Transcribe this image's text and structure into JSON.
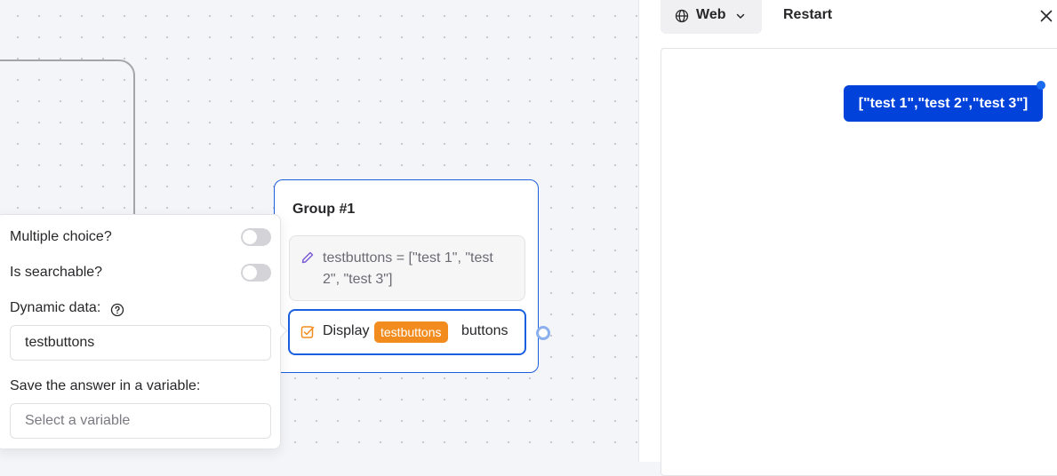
{
  "canvas": {
    "group": {
      "title": "Group #1",
      "set_variable_text": "testbuttons = [\"test 1\", \"test 2\", \"test 3\"]",
      "buttons_block": {
        "prefix": "Display",
        "variable_tag": "testbuttons",
        "suffix": "buttons"
      }
    }
  },
  "settings_popover": {
    "multiple_choice_label": "Multiple choice?",
    "multiple_choice_enabled": false,
    "searchable_label": "Is searchable?",
    "searchable_enabled": false,
    "dynamic_data_label": "Dynamic data:",
    "dynamic_data_value": "testbuttons",
    "save_variable_label": "Save the answer in a variable:",
    "save_variable_placeholder": "Select a variable"
  },
  "preview_panel": {
    "runtime_label": "Web",
    "restart_label": "Restart",
    "message_bubble": "[\"test 1\",\"test 2\",\"test 3\"]"
  },
  "colors": {
    "accent": "#1a5fe0",
    "variable_tag": "#f28c1f",
    "bubble": "#0042da",
    "canvas_bg": "#f4f5f8"
  },
  "icons": [
    "pencil-icon",
    "checkbox-icon",
    "help-icon",
    "globe-icon",
    "chevron-down-icon",
    "close-icon"
  ]
}
